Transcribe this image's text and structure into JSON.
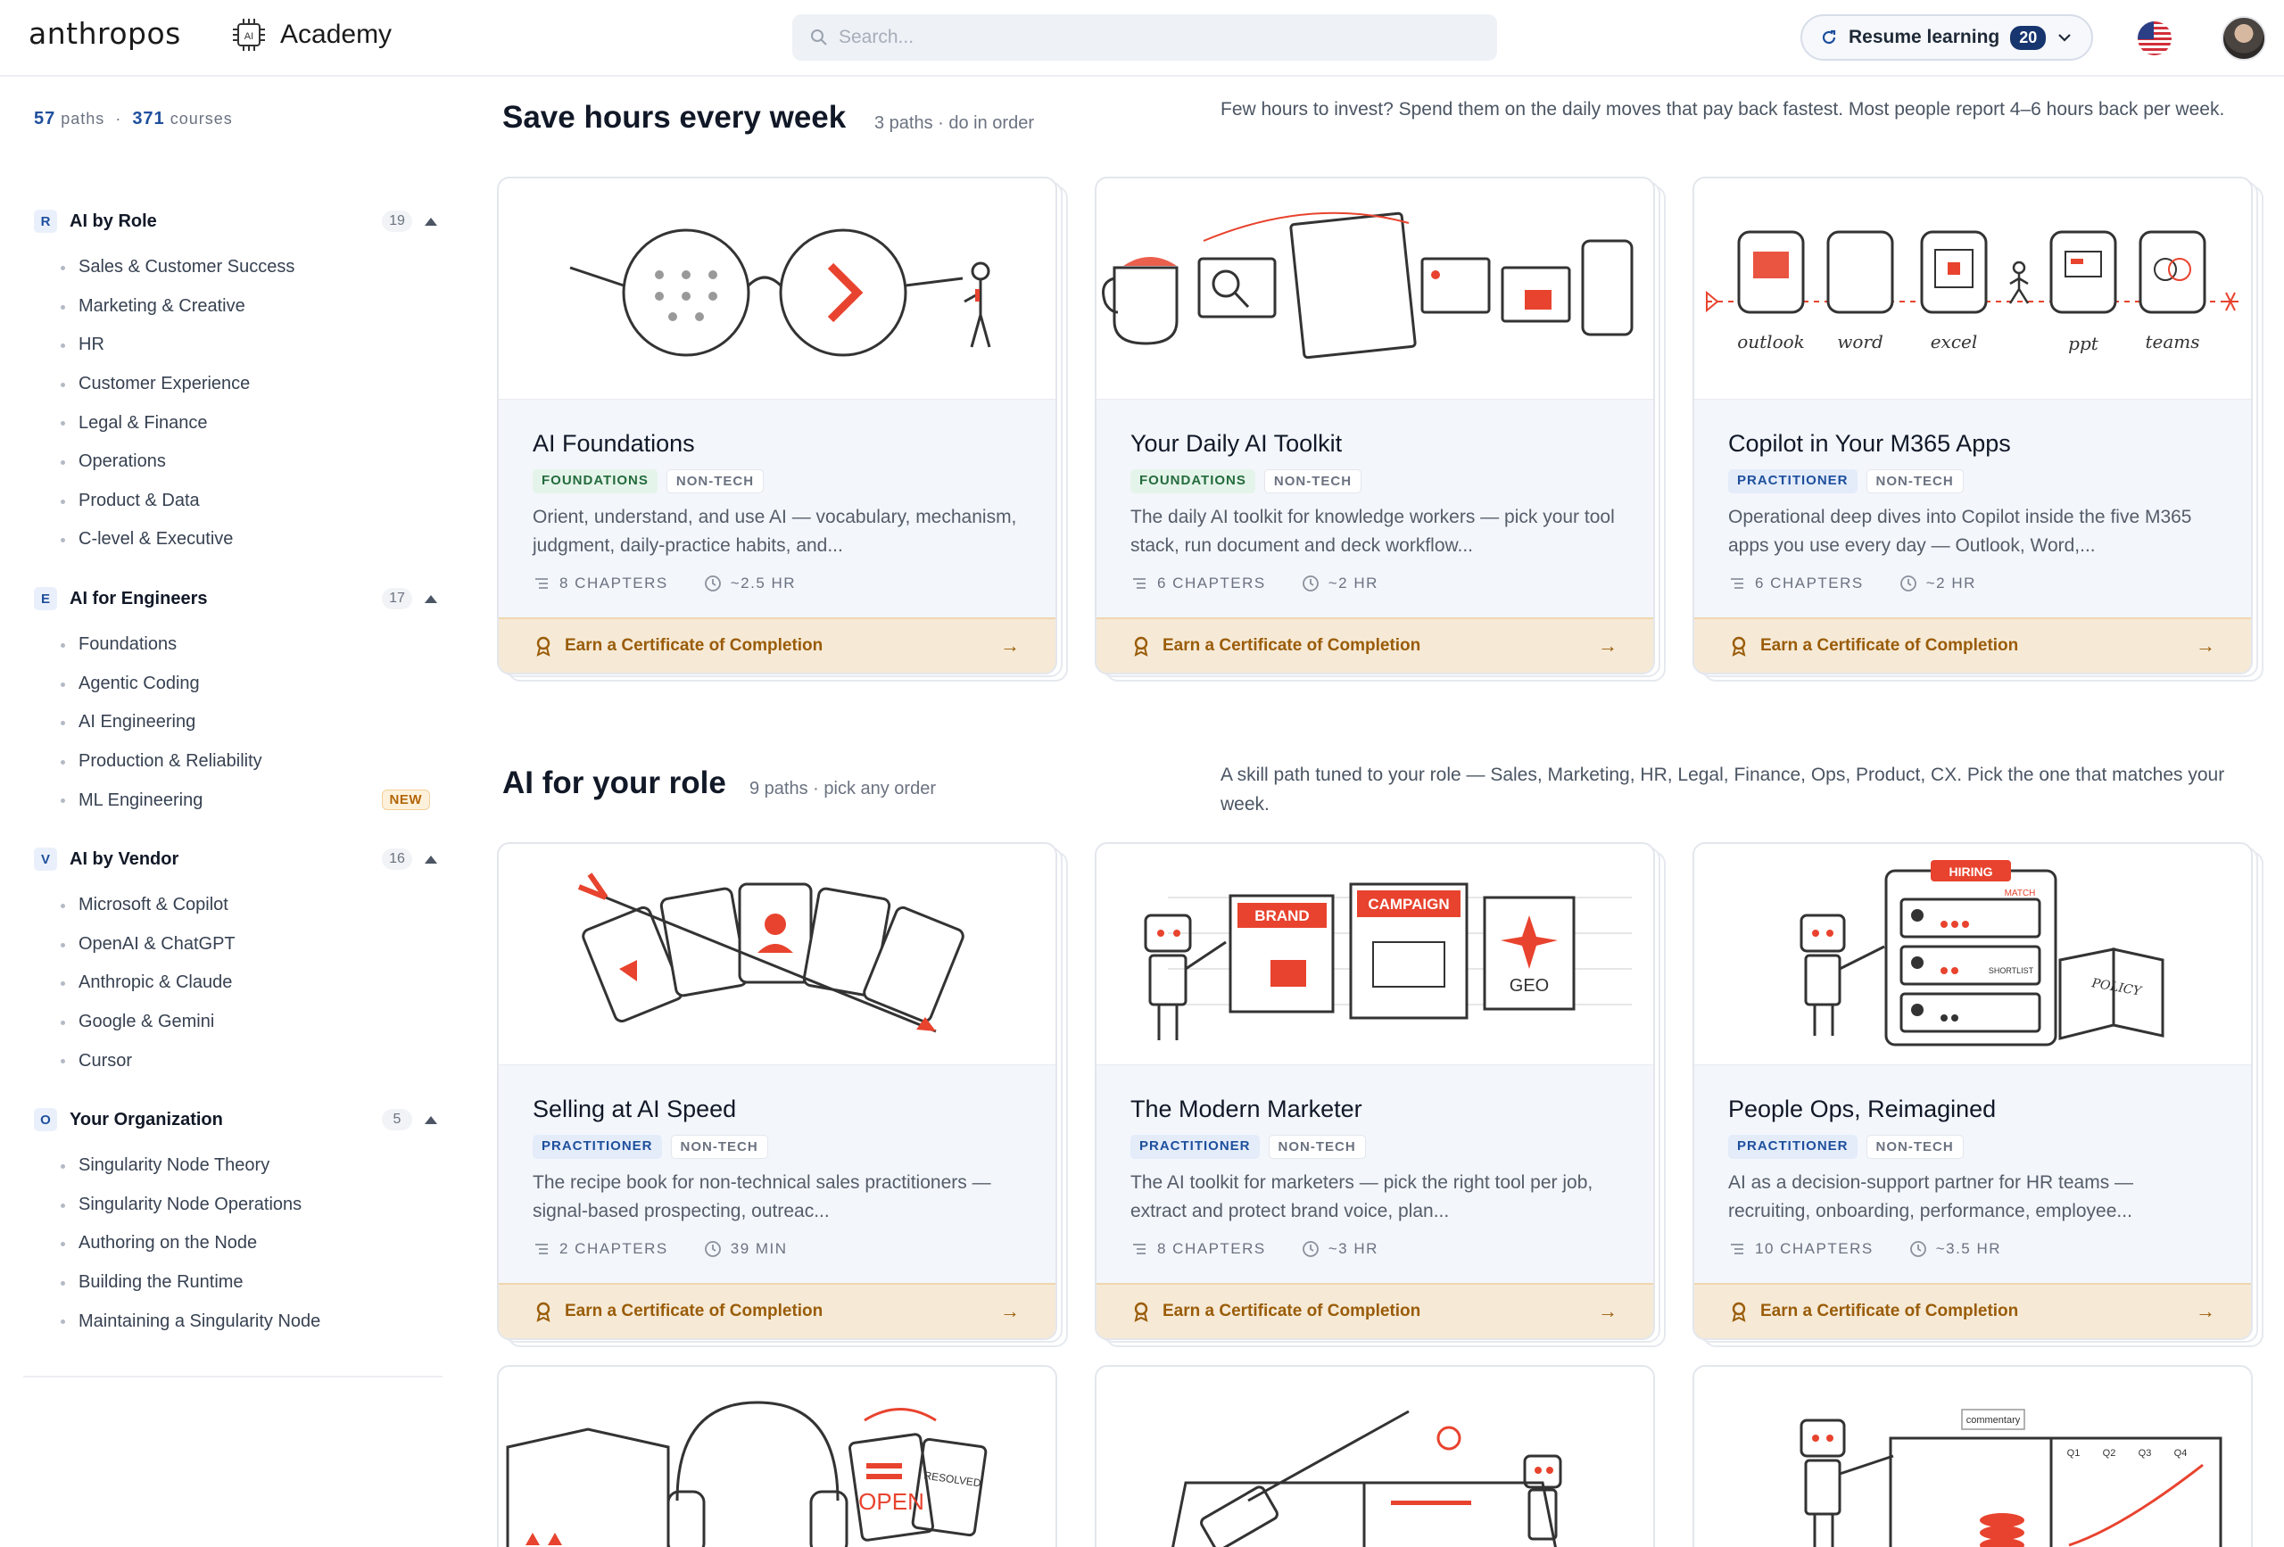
{
  "header": {
    "brand": "anthropos",
    "academy_label": "Academy",
    "academy_icon": "ai-chip-icon",
    "search_placeholder": "Search...",
    "resume_label": "Resume learning",
    "resume_count": "20"
  },
  "sidebar": {
    "paths_count": "57",
    "paths_label": "paths",
    "courses_count": "371",
    "courses_label": "courses",
    "groups": [
      {
        "letter": "R",
        "title": "AI by Role",
        "count": "19",
        "items": [
          "Sales & Customer Success",
          "Marketing & Creative",
          "HR",
          "Customer Experience",
          "Legal & Finance",
          "Operations",
          "Product & Data",
          "C-level & Executive"
        ]
      },
      {
        "letter": "E",
        "title": "AI for Engineers",
        "count": "17",
        "items": [
          "Foundations",
          "Agentic Coding",
          "AI Engineering",
          "Production & Reliability",
          "ML Engineering"
        ],
        "new_badge": "NEW"
      },
      {
        "letter": "V",
        "title": "AI by Vendor",
        "count": "16",
        "items": [
          "Microsoft & Copilot",
          "OpenAI & ChatGPT",
          "Anthropic & Claude",
          "Google & Gemini",
          "Cursor"
        ]
      },
      {
        "letter": "O",
        "title": "Your Organization",
        "count": "5",
        "items": [
          "Singularity Node Theory",
          "Singularity Node Operations",
          "Authoring on the Node",
          "Building the Runtime",
          "Maintaining a Singularity Node"
        ]
      }
    ]
  },
  "sections": [
    {
      "title": "Save hours every week",
      "meta": "3 paths · do in order",
      "description": "Few hours to invest? Spend them on the daily moves that pay back fastest. Most people report 4–6 hours back per week."
    },
    {
      "title": "AI for your role",
      "meta": "9 paths · pick any order",
      "description": "A skill path tuned to your role — Sales, Marketing, HR, Legal, Finance, Ops, Product, CX. Pick the one that matches your week."
    }
  ],
  "cards": [
    {
      "title": "AI Foundations",
      "level": "FOUNDATIONS",
      "kind": "NON-TECH",
      "description": "Orient, understand, and use AI — vocabulary, mechanism, judgment, daily-practice habits, and...",
      "chapters": "8 CHAPTERS",
      "duration": "~2.5 HR",
      "cert": "Earn a Certificate of Completion"
    },
    {
      "title": "Your Daily AI Toolkit",
      "level": "FOUNDATIONS",
      "kind": "NON-TECH",
      "description": "The daily AI toolkit for knowledge workers — pick your tool stack, run document and deck workflow...",
      "chapters": "6 CHAPTERS",
      "duration": "~2 HR",
      "cert": "Earn a Certificate of Completion"
    },
    {
      "title": "Copilot in Your M365 Apps",
      "level": "PRACTITIONER",
      "kind": "NON-TECH",
      "description": "Operational deep dives into Copilot inside the five M365 apps you use every day — Outlook, Word,...",
      "chapters": "6 CHAPTERS",
      "duration": "~2 HR",
      "cert": "Earn a Certificate of Completion",
      "art_labels": [
        "outlook",
        "word",
        "excel",
        "ppt",
        "teams"
      ]
    },
    {
      "title": "Selling at AI Speed",
      "level": "PRACTITIONER",
      "kind": "NON-TECH",
      "description": "The recipe book for non-technical sales practitioners — signal-based prospecting, outreac...",
      "chapters": "2 CHAPTERS",
      "duration": "39 MIN",
      "cert": "Earn a Certificate of Completion"
    },
    {
      "title": "The Modern Marketer",
      "level": "PRACTITIONER",
      "kind": "NON-TECH",
      "description": "The AI toolkit for marketers — pick the right tool per job, extract and protect brand voice, plan...",
      "chapters": "8 CHAPTERS",
      "duration": "~3 HR",
      "cert": "Earn a Certificate of Completion",
      "art_labels": [
        "BRAND",
        "CAMPAIGN",
        "GEO"
      ]
    },
    {
      "title": "People Ops, Reimagined",
      "level": "PRACTITIONER",
      "kind": "NON-TECH",
      "description": "AI as a decision-support partner for HR teams — recruiting, onboarding, performance, employee...",
      "chapters": "10 CHAPTERS",
      "duration": "~3.5 HR",
      "cert": "Earn a Certificate of Completion",
      "art_labels": [
        "HIRING",
        "MATCH",
        "SHORTLIST",
        "POLICY"
      ]
    }
  ],
  "bottom_art_labels": [
    "OPEN",
    "RESOLVED",
    "commentary",
    "Q1",
    "Q2",
    "Q3",
    "Q4"
  ],
  "colors": {
    "accent": "#e8432e",
    "brand_blue": "#1e4f9c",
    "cert_bg": "#f6ead6",
    "cert_text": "#9a5c09"
  }
}
